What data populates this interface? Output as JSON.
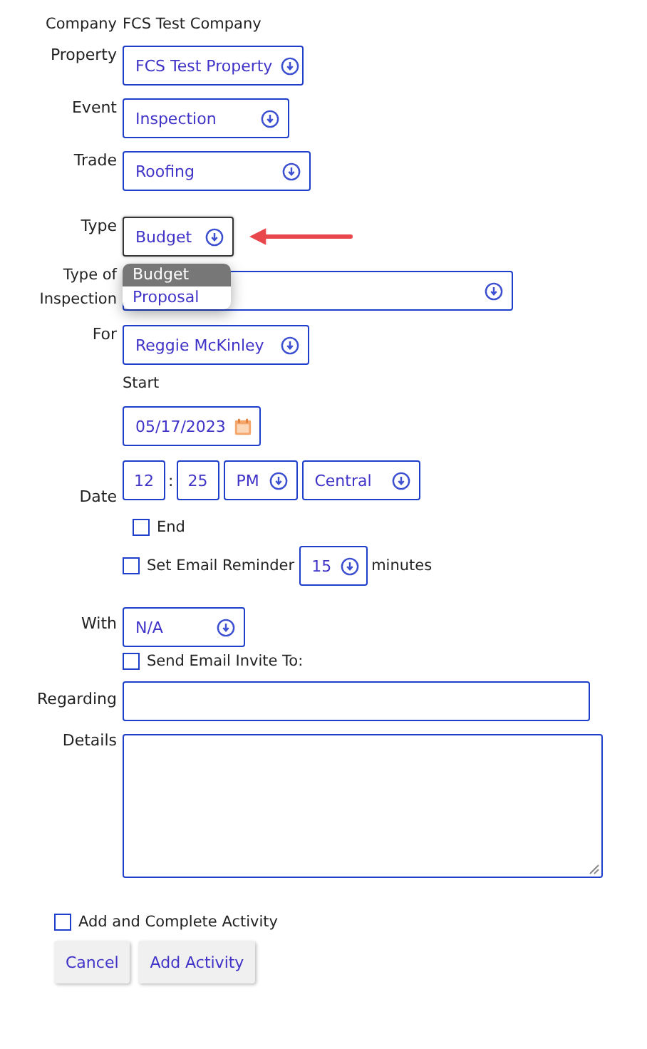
{
  "company": {
    "label": "Company",
    "value": "FCS Test Company"
  },
  "property": {
    "label": "Property",
    "value": "FCS Test Property"
  },
  "event": {
    "label": "Event",
    "value": "Inspection"
  },
  "trade": {
    "label": "Trade",
    "value": "Roofing"
  },
  "type": {
    "label": "Type",
    "value": "Budget",
    "expanded": true,
    "options": [
      {
        "label": "Budget",
        "selected": true
      },
      {
        "label": "Proposal",
        "selected": false
      }
    ]
  },
  "type_of_inspection": {
    "label": "Type of Inspection"
  },
  "for": {
    "label": "For",
    "value": "Reggie McKinley"
  },
  "start": {
    "label": "Start",
    "date": "05/17/2023"
  },
  "date": {
    "label": "Date",
    "hour": "12",
    "separator": ":",
    "minute": "25",
    "ampm": "PM",
    "timezone": "Central"
  },
  "end": {
    "label": "End",
    "checked": false
  },
  "reminder": {
    "label": "Set Email Reminder",
    "checked": false,
    "minutes": "15",
    "unit": "minutes"
  },
  "with": {
    "label": "With",
    "value": "N/A"
  },
  "send_invite": {
    "label": "Send Email Invite To:",
    "checked": false
  },
  "regarding": {
    "label": "Regarding"
  },
  "details": {
    "label": "Details"
  },
  "add_complete": {
    "label": "Add and Complete Activity",
    "checked": false
  },
  "buttons": [
    {
      "label": "Cancel"
    },
    {
      "label": "Add Activity"
    }
  ]
}
